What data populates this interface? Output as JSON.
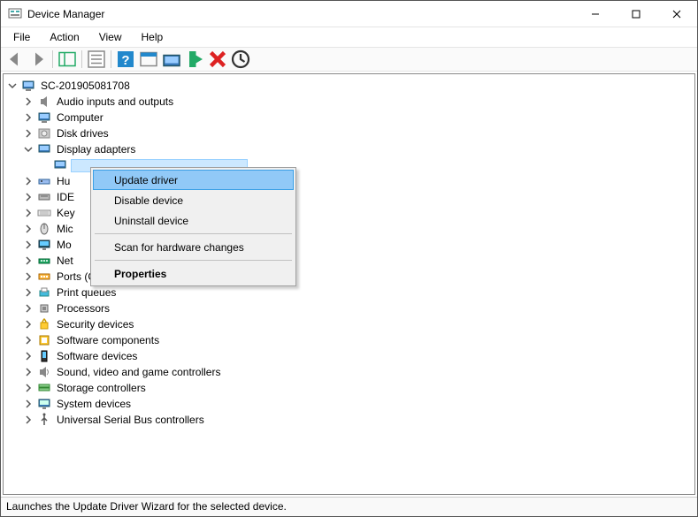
{
  "window": {
    "title": "Device Manager"
  },
  "menubar": {
    "file": "File",
    "action": "Action",
    "view": "View",
    "help": "Help"
  },
  "tree": {
    "root": "SC-201905081708",
    "nodes": [
      {
        "label": "Audio inputs and outputs",
        "ico": "audio"
      },
      {
        "label": "Computer",
        "ico": "computer"
      },
      {
        "label": "Disk drives",
        "ico": "disk"
      },
      {
        "label": "Display adapters",
        "ico": "display",
        "expanded": true,
        "selected_child": ""
      },
      {
        "label": "Hu",
        "ico": "hid",
        "truncated": true
      },
      {
        "label": "IDE",
        "ico": "ide",
        "truncated": true
      },
      {
        "label": "Key",
        "ico": "keyb",
        "truncated": true
      },
      {
        "label": "Mic",
        "ico": "mouse",
        "truncated": true
      },
      {
        "label": "Mo",
        "ico": "monitor",
        "truncated": true
      },
      {
        "label": "Net",
        "ico": "net",
        "truncated": true
      },
      {
        "label": "Ports (COM & LPT)",
        "ico": "ports"
      },
      {
        "label": "Print queues",
        "ico": "print"
      },
      {
        "label": "Processors",
        "ico": "cpu"
      },
      {
        "label": "Security devices",
        "ico": "security"
      },
      {
        "label": "Software components",
        "ico": "swcomp"
      },
      {
        "label": "Software devices",
        "ico": "swdev"
      },
      {
        "label": "Sound, video and game controllers",
        "ico": "sound"
      },
      {
        "label": "Storage controllers",
        "ico": "storage"
      },
      {
        "label": "System devices",
        "ico": "system"
      },
      {
        "label": "Universal Serial Bus controllers",
        "ico": "usb"
      }
    ]
  },
  "context_menu": {
    "update": "Update driver",
    "disable": "Disable device",
    "uninstall": "Uninstall device",
    "scan": "Scan for hardware changes",
    "properties": "Properties"
  },
  "statusbar": {
    "text": "Launches the Update Driver Wizard for the selected device."
  }
}
